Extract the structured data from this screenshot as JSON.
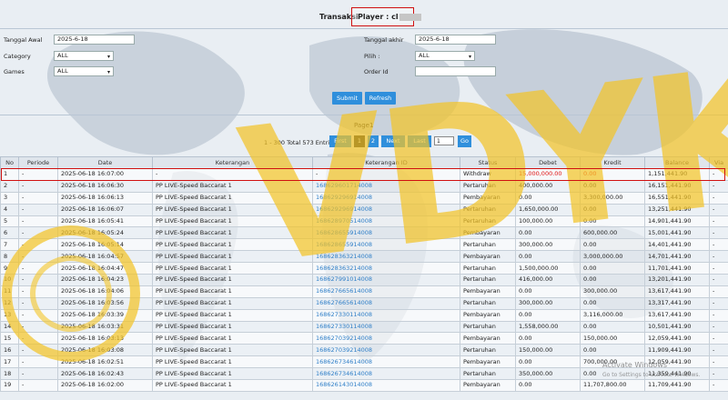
{
  "header": {
    "title": "Transaksi",
    "player_label": "Player : cl"
  },
  "filters": {
    "tanggal_awal_label": "Tanggal Awal",
    "tanggal_awal_value": "2025-6-18",
    "category_label": "Category",
    "category_value": "ALL",
    "games_label": "Games",
    "games_value": "ALL",
    "tanggal_akhir_label": "Tanggal akhir",
    "tanggal_akhir_value": "2025-6-18",
    "pilih_label": "Pilih :",
    "pilih_value": "ALL",
    "order_label": "Order Id",
    "order_value": ""
  },
  "buttons": {
    "submit": "Submit",
    "refresh": "Refresh"
  },
  "pager": {
    "page_label": "Page1",
    "info": "1 - 300 Total 573 Entri",
    "first": "First",
    "p1": "1",
    "p2": "2",
    "next": "Next",
    "last": "Last",
    "goto_value": "1",
    "go": "Go"
  },
  "table": {
    "headers": [
      "No",
      "Periode",
      "Date",
      "Keterangan",
      "Keterangan ID",
      "Status",
      "Debet",
      "Kredit",
      "Balance",
      "Via"
    ],
    "rows": [
      [
        "1",
        "-",
        "2025-06-18 16:07:00",
        "-",
        "-",
        "Withdraw",
        "15,000,000.00",
        "0.00",
        "1,151,441.90",
        "-"
      ],
      [
        "2",
        "-",
        "2025-06-18 16:06:30",
        "PP LIVE-Speed Baccarat 1",
        "168629601714008",
        "Pertaruhan",
        "400,000.00",
        "0.00",
        "16,151,441.90",
        "-"
      ],
      [
        "3",
        "-",
        "2025-06-18 16:06:13",
        "PP LIVE-Speed Baccarat 1",
        "168629296914008",
        "Pembayaran",
        "0.00",
        "3,300,000.00",
        "16,551,441.90",
        "-"
      ],
      [
        "4",
        "-",
        "2025-06-18 16:06:07",
        "PP LIVE-Speed Baccarat 1",
        "168629296914008",
        "Pertaruhan",
        "1,650,000.00",
        "0.00",
        "13,251,441.90",
        "-"
      ],
      [
        "5",
        "-",
        "2025-06-18 16:05:41",
        "PP LIVE-Speed Baccarat 1",
        "168628970514008",
        "Pertaruhan",
        "100,000.00",
        "0.00",
        "14,901,441.90",
        "-"
      ],
      [
        "6",
        "-",
        "2025-06-18 16:05:24",
        "PP LIVE-Speed Baccarat 1",
        "168628655914008",
        "Pembayaran",
        "0.00",
        "600,000.00",
        "15,001,441.90",
        "-"
      ],
      [
        "7",
        "-",
        "2025-06-18 16:05:14",
        "PP LIVE-Speed Baccarat 1",
        "168628655914008",
        "Pertaruhan",
        "300,000.00",
        "0.00",
        "14,401,441.90",
        "-"
      ],
      [
        "8",
        "-",
        "2025-06-18 16:04:57",
        "PP LIVE-Speed Baccarat 1",
        "168628363214008",
        "Pembayaran",
        "0.00",
        "3,000,000.00",
        "14,701,441.90",
        "-"
      ],
      [
        "9",
        "-",
        "2025-06-18 16:04:47",
        "PP LIVE-Speed Baccarat 1",
        "168628363214008",
        "Pertaruhan",
        "1,500,000.00",
        "0.00",
        "11,701,441.90",
        "-"
      ],
      [
        "10",
        "-",
        "2025-06-18 16:04:23",
        "PP LIVE-Speed Baccarat 1",
        "168627991014008",
        "Pertaruhan",
        "416,000.00",
        "0.00",
        "13,201,441.90",
        "-"
      ],
      [
        "11",
        "-",
        "2025-06-18 16:04:06",
        "PP LIVE-Speed Baccarat 1",
        "168627665614008",
        "Pembayaran",
        "0.00",
        "300,000.00",
        "13,617,441.90",
        "-"
      ],
      [
        "12",
        "-",
        "2025-06-18 16:03:56",
        "PP LIVE-Speed Baccarat 1",
        "168627665614008",
        "Pertaruhan",
        "300,000.00",
        "0.00",
        "13,317,441.90",
        "-"
      ],
      [
        "13",
        "-",
        "2025-06-18 16:03:39",
        "PP LIVE-Speed Baccarat 1",
        "168627330114008",
        "Pembayaran",
        "0.00",
        "3,116,000.00",
        "13,617,441.90",
        "-"
      ],
      [
        "14",
        "-",
        "2025-06-18 16:03:31",
        "PP LIVE-Speed Baccarat 1",
        "168627330114008",
        "Pertaruhan",
        "1,558,000.00",
        "0.00",
        "10,501,441.90",
        "-"
      ],
      [
        "15",
        "-",
        "2025-06-18 16:03:13",
        "PP LIVE-Speed Baccarat 1",
        "168627039214008",
        "Pembayaran",
        "0.00",
        "150,000.00",
        "12,059,441.90",
        "-"
      ],
      [
        "16",
        "-",
        "2025-06-18 16:03:08",
        "PP LIVE-Speed Baccarat 1",
        "168627039214008",
        "Pertaruhan",
        "150,000.00",
        "0.00",
        "11,909,441.90",
        "-"
      ],
      [
        "17",
        "-",
        "2025-06-18 16:02:51",
        "PP LIVE-Speed Baccarat 1",
        "168626734614008",
        "Pembayaran",
        "0.00",
        "700,000.00",
        "12,059,441.90",
        "-"
      ],
      [
        "18",
        "-",
        "2025-06-18 16:02:43",
        "PP LIVE-Speed Baccarat 1",
        "168626734614008",
        "Pertaruhan",
        "350,000.00",
        "0.00",
        "11,359,441.90",
        "-"
      ],
      [
        "19",
        "-",
        "2025-06-18 16:02:00",
        "PP LIVE-Speed Baccarat 1",
        "168626143014008",
        "Pembayaran",
        "0.00",
        "11,707,800.00",
        "11,709,441.90",
        "-"
      ]
    ]
  },
  "watermark": {
    "brand": "VDYK"
  },
  "windows_notice": {
    "line1": "Activate Windows",
    "line2": "Go to Settings to activate Windows."
  },
  "colors": {
    "accent": "#2f8fdc",
    "highlight": "#d01010",
    "link": "#2f7fc8",
    "watermark": "#f3c428"
  }
}
